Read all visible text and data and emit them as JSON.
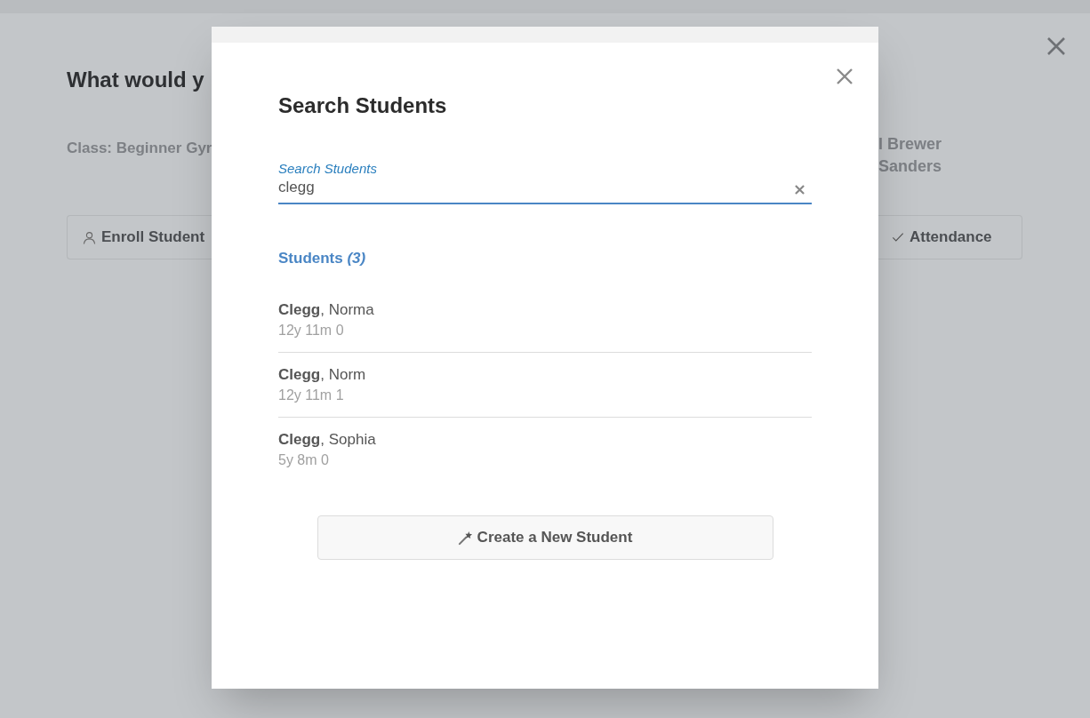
{
  "background": {
    "heading": "What would y",
    "class_info": "**Class:** Beginner Gyr",
    "teachers": [
      "l Brewer",
      "Sanders"
    ],
    "buttons": [
      "Enroll Student",
      "Attendance"
    ]
  },
  "dialog": {
    "title": "Search Students",
    "search": {
      "label": "Search Students",
      "value": "clegg"
    },
    "results_heading": "Students *(3)*",
    "students": [
      {
        "name": "**Clegg**, Norma",
        "age": "12y 11m 0"
      },
      {
        "name": "**Clegg**, Norm",
        "age": "12y 11m 1"
      },
      {
        "name": "**Clegg**, Sophia",
        "age": "5y 8m 0"
      }
    ],
    "create_button": "Create a New Student"
  }
}
